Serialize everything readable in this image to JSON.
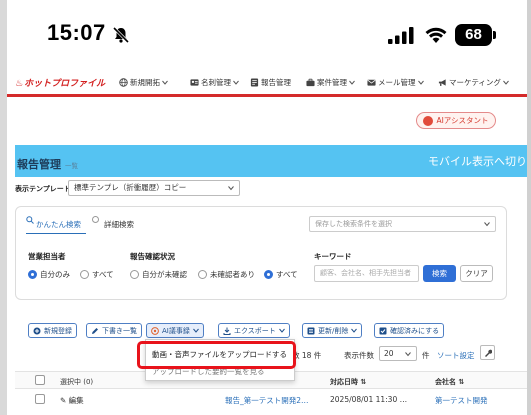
{
  "status_bar": {
    "time": "15:07",
    "battery": "68"
  },
  "nav": {
    "logo": "ホットプロファイル",
    "items": [
      {
        "icon": "globe-icon",
        "label": "新規開拓",
        "has_menu": true
      },
      {
        "icon": "person-card-icon",
        "label": "名刺管理",
        "has_menu": true
      },
      {
        "icon": "report-icon",
        "label": "報告管理",
        "has_menu": false
      },
      {
        "icon": "briefcase-icon",
        "label": "案件管理",
        "has_menu": true
      },
      {
        "icon": "mail-icon",
        "label": "メール管理",
        "has_menu": true
      },
      {
        "icon": "megaphone-icon",
        "label": "マーケティング",
        "has_menu": true
      }
    ]
  },
  "assistant_button": "AIアシスタント",
  "page": {
    "title": "報告管理",
    "subtitle": "一覧",
    "mobile_toggle": "モバイル表示へ切り"
  },
  "template": {
    "label": "表示テンプレート",
    "value": "標準テンプレ（折衝履歴）コピー"
  },
  "search": {
    "tab_simple": "かんたん検索",
    "tab_detail": "詳細検索",
    "saved_placeholder": "保存した検索条件を選択",
    "groups": [
      {
        "label": "営業担当者",
        "options": [
          "自分のみ",
          "すべて"
        ],
        "selected": 0
      },
      {
        "label": "報告確認状況",
        "options": [
          "自分が未確認",
          "未確認者あり",
          "すべて"
        ],
        "selected": 2
      }
    ],
    "keyword_label": "キーワード",
    "keyword_placeholder": "顧客、会社名、相手先担当者",
    "search_button": "検索",
    "clear_button": "クリア"
  },
  "toolbar": {
    "new": "新規登録",
    "drafts": "下書き一覧",
    "ai_log": "AI議事録",
    "export": "エクスポート",
    "update_delete": "更新/削除",
    "confirmed": "確認済みにする"
  },
  "ai_menu": {
    "item1": "動画・音声ファイルをアップロードする",
    "item2": "アップロードした要約一覧を見る"
  },
  "listing": {
    "count_text": "数 18 件",
    "per_page_label": "表示件数",
    "per_page": "20",
    "unit": "件",
    "sort": "ソート設定"
  },
  "table": {
    "headers": {
      "selected": "選択中 (0)",
      "date": "対応日時",
      "company": "会社名"
    },
    "rows": [
      {
        "action": "編集",
        "report": "報告_第一テスト開発2…",
        "date": "2025/08/01 11:30 …",
        "company": "第一テスト開発"
      }
    ]
  },
  "colors": {
    "brand_red": "#d31f1f",
    "title_band": "#55c3f2",
    "primary_blue": "#2f6fd6",
    "highlight_red": "#e8131b"
  }
}
